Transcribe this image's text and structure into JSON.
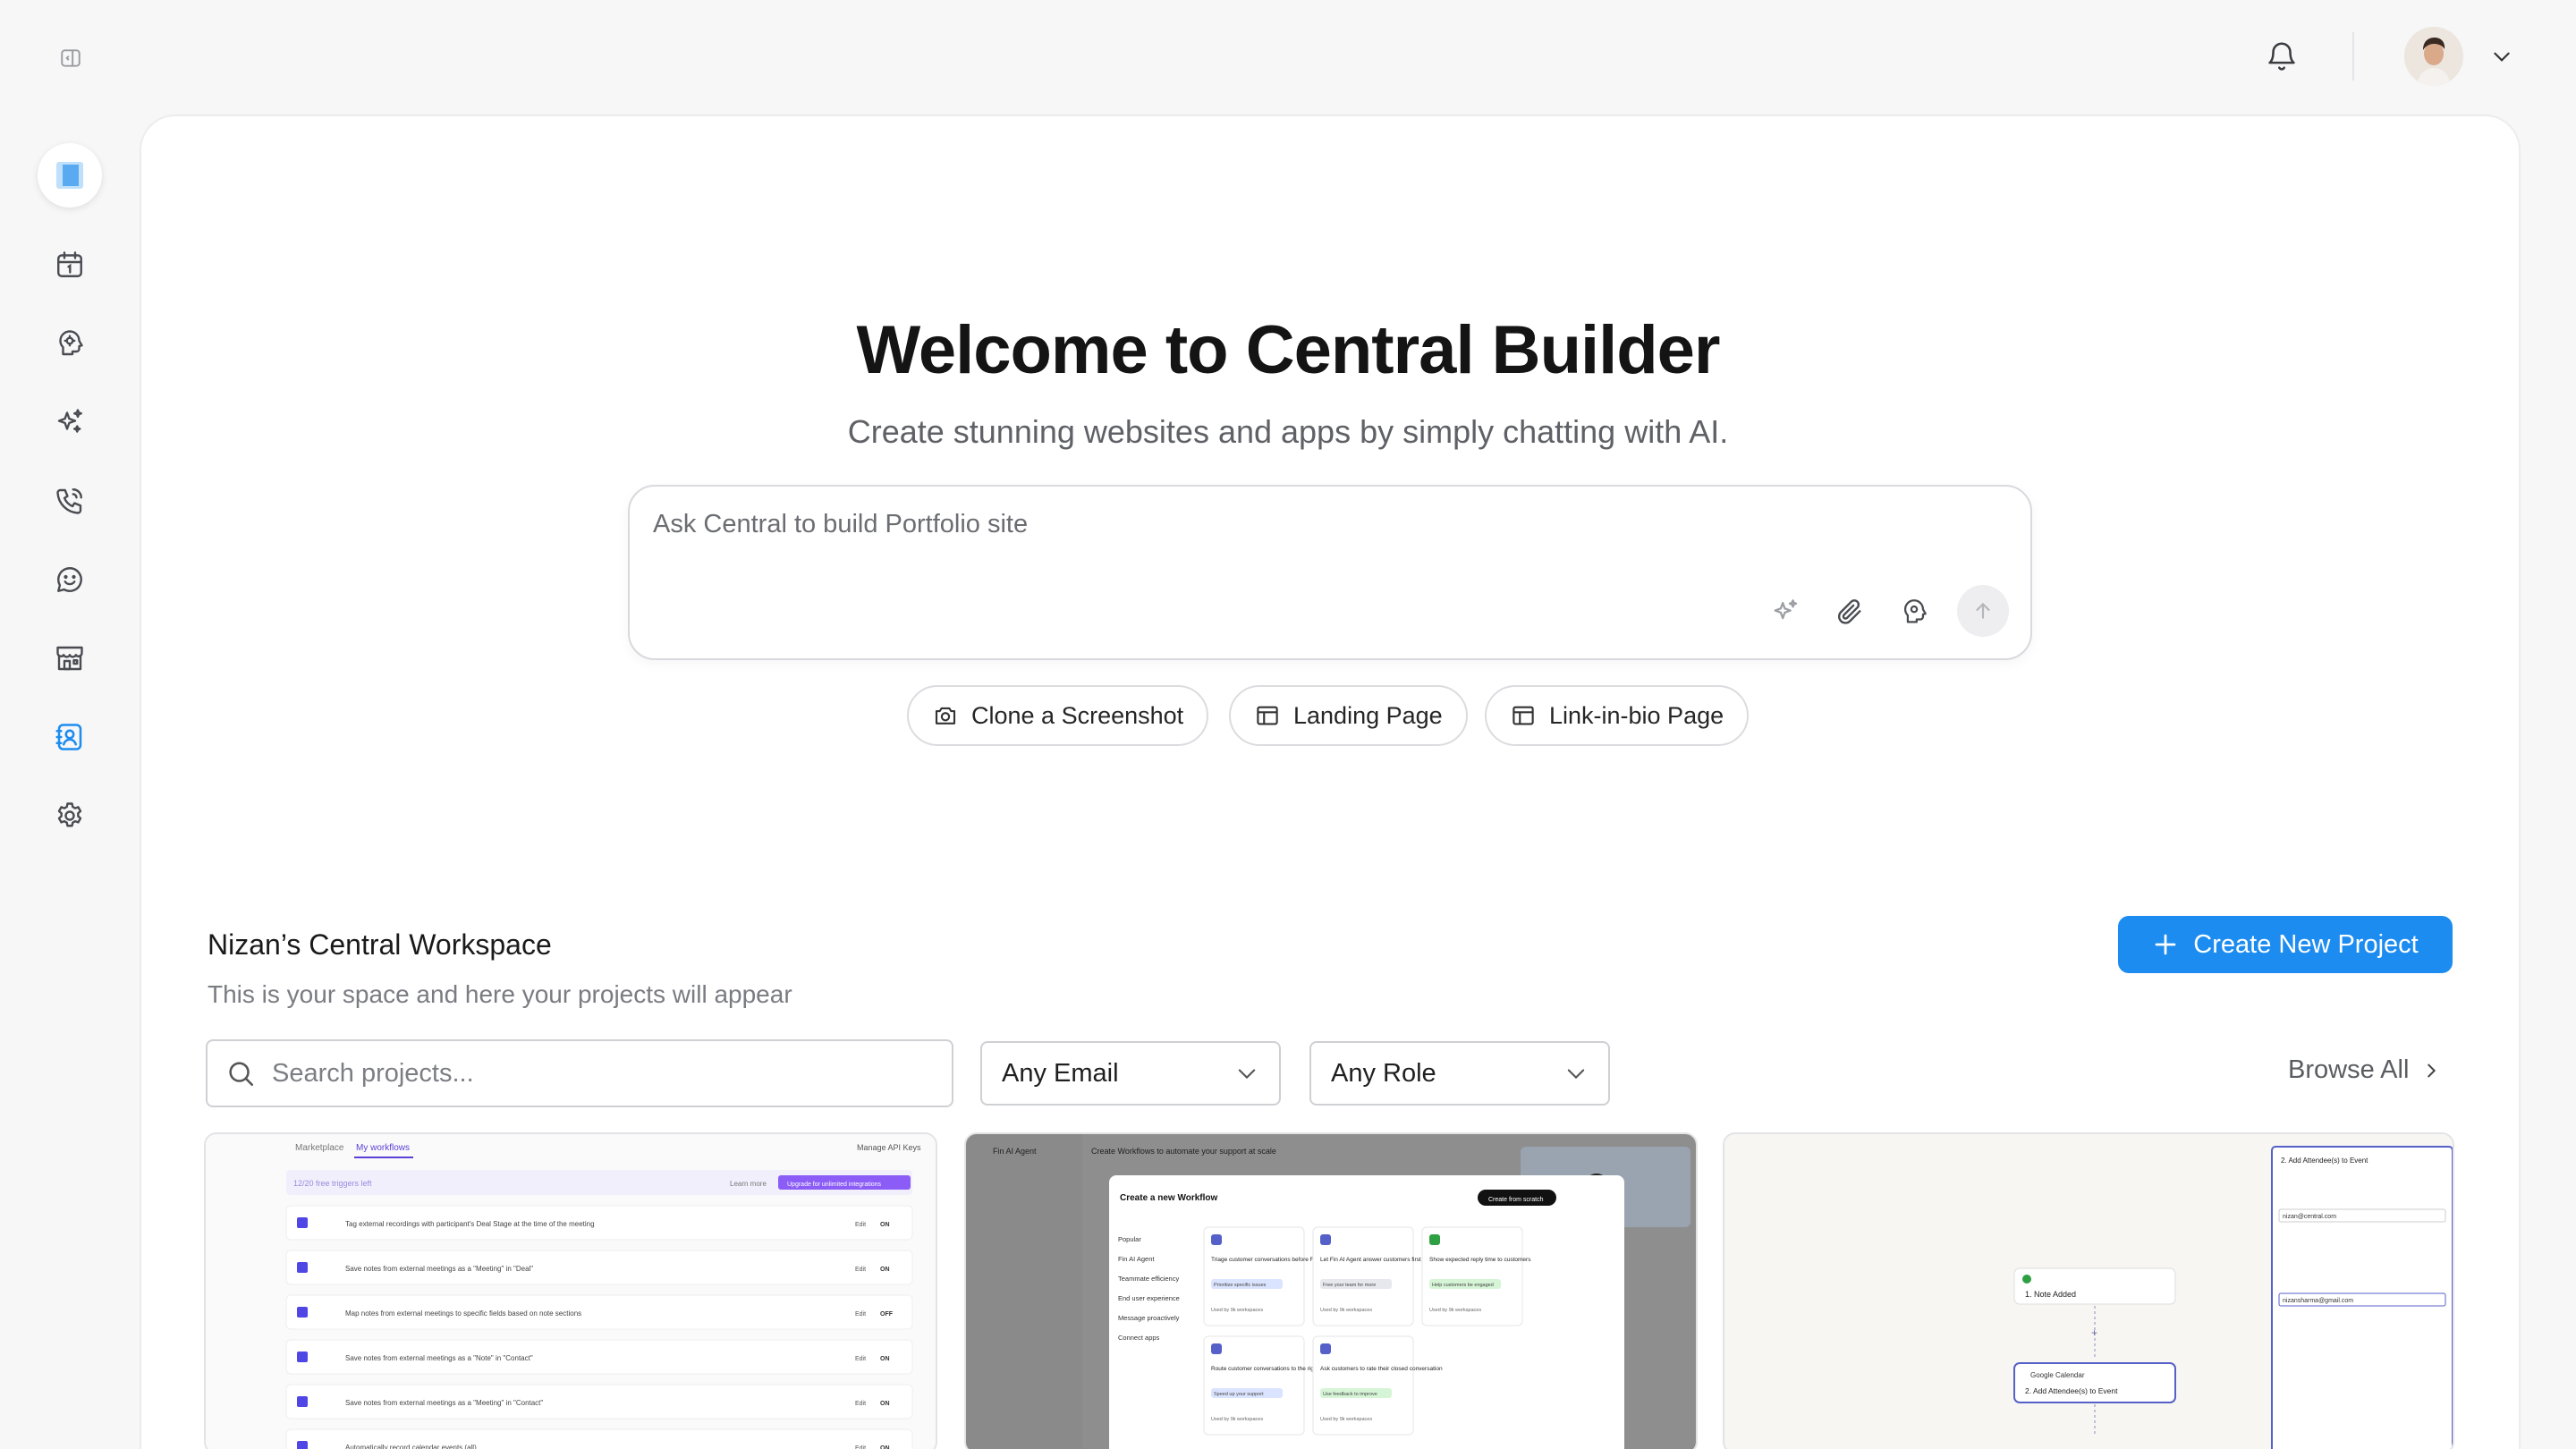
{
  "header": {
    "collapse_icon": "sidebar-collapse-icon",
    "bell_icon": "bell-icon",
    "avatar_alt": "user avatar",
    "chevron_icon": "chevron-down-icon"
  },
  "sidebar": {
    "items": [
      {
        "name": "logo",
        "icon": "app-logo-icon"
      },
      {
        "name": "calendar",
        "icon": "calendar-icon"
      },
      {
        "name": "brain",
        "icon": "brain-icon"
      },
      {
        "name": "sparkles",
        "icon": "sparkles-icon"
      },
      {
        "name": "phone",
        "icon": "phone-icon"
      },
      {
        "name": "chat",
        "icon": "chat-smile-icon"
      },
      {
        "name": "store",
        "icon": "store-icon"
      },
      {
        "name": "contacts",
        "icon": "contact-book-icon",
        "active": true
      },
      {
        "name": "settings",
        "icon": "gear-icon"
      }
    ]
  },
  "hero": {
    "title": "Welcome to  Central Builder",
    "subtitle": "Create stunning websites and apps by simply chatting with AI.",
    "prompt_placeholder": "Ask Central to build Portfolio site",
    "chips": [
      {
        "label": "Clone a Screenshot",
        "icon": "camera-icon"
      },
      {
        "label": "Landing Page",
        "icon": "layout-icon"
      },
      {
        "label": "Link-in-bio Page",
        "icon": "layout-icon"
      }
    ]
  },
  "workspace": {
    "title": "Nizan’s Central Workspace",
    "subtitle": "This is your space and here your projects will appear",
    "create_label": "Create New Project",
    "search_placeholder": "Search projects...",
    "email_filter": "Any Email",
    "role_filter": "Any Role",
    "browse_label": "Browse All"
  },
  "cards": {
    "card1": {
      "tab_marketplace": "Marketplace",
      "tab_workflows": "My workflows",
      "manage_keys": "Manage API Keys",
      "triggers_left": "12/20 free triggers left",
      "learn_more": "Learn more",
      "upgrade": "Upgrade for unlimited integrations",
      "rows": [
        {
          "text": "Tag external recordings with participant's Deal Stage at the time of the meeting",
          "state": "ON"
        },
        {
          "text": "Save notes from external meetings as a \"Meeting\" in \"Deal\"",
          "state": "ON"
        },
        {
          "text": "Map notes from external meetings to specific fields based on note sections",
          "state": "OFF"
        },
        {
          "text": "Save notes from external meetings as a \"Note\" in \"Contact\"",
          "state": "ON"
        },
        {
          "text": "Save notes from external meetings as a \"Meeting\" in \"Contact\"",
          "state": "ON"
        },
        {
          "text": "Automatically record calendar events (all)",
          "state": "ON"
        }
      ],
      "edit_label": "Edit"
    },
    "card2": {
      "sidebar_title": "Fin AI Agent",
      "header": "Create Workflows to automate your support at scale",
      "modal_title": "Create a new Workflow",
      "modal_button": "Create from scratch",
      "modal_categories": [
        "Popular",
        "Fin AI Agent",
        "Teammate efficiency",
        "End user experience",
        "Message proactively",
        "Connect apps"
      ],
      "modal_cards": [
        {
          "title": "Triage customer conversations before Fin...",
          "tag": "Prioritize specific issues"
        },
        {
          "title": "Let Fin AI Agent answer customers first",
          "tag": "Free your team for more"
        },
        {
          "title": "Show expected reply time to customers",
          "tag": "Help customers be engaged"
        },
        {
          "title": "Route customer conversations to the right...",
          "tag": "Speed up your support"
        },
        {
          "title": "Ask customers to rate their closed conversation",
          "tag": "Use feedback to improve"
        }
      ],
      "used_by": "Used by 9k workspaces"
    },
    "card3": {
      "node1_title": "1. Note Added",
      "node2_app": "Google Calendar",
      "node2_title": "2. Add Attendee(s) to Event",
      "panel_title": "2. Add Attendee(s) to Event",
      "email1": "nizan@central.com",
      "email2": "nizansharma@gmail.com"
    }
  }
}
